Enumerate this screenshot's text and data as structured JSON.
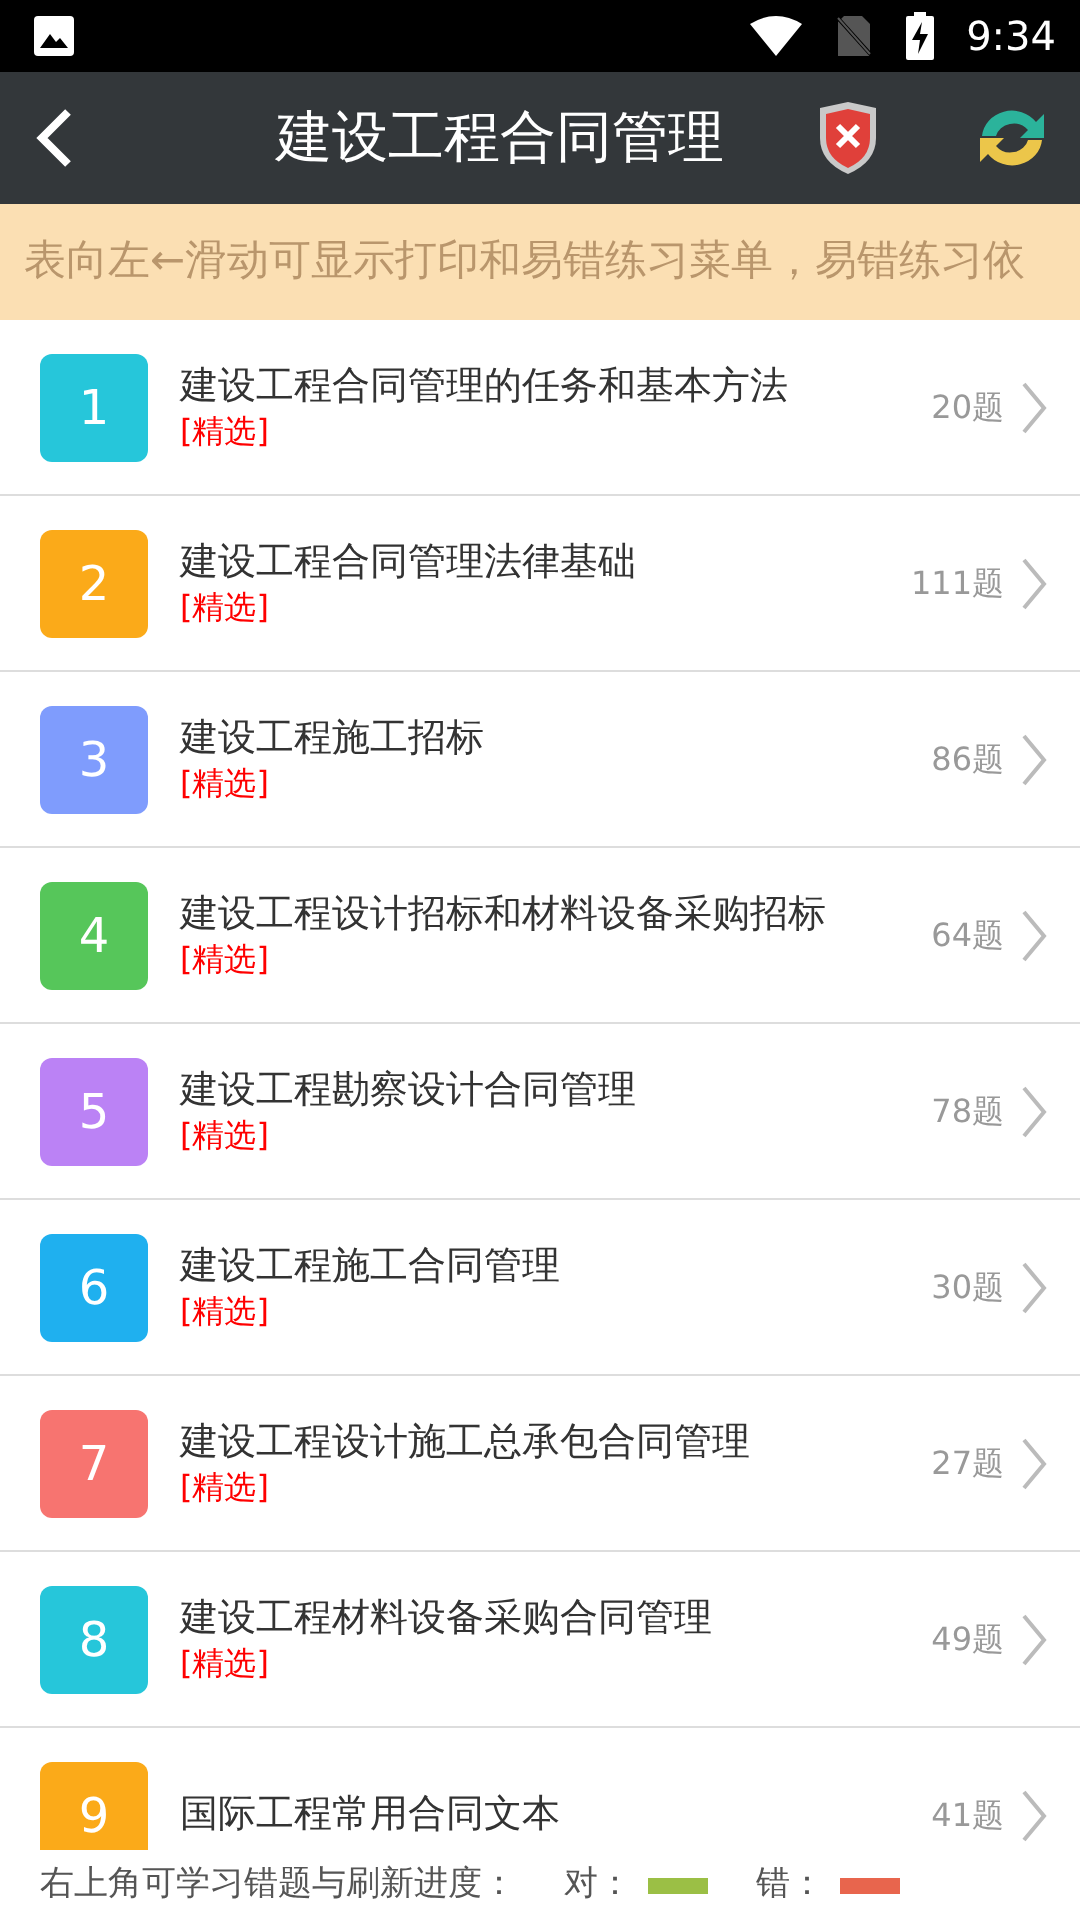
{
  "status_bar": {
    "time": "9:34"
  },
  "header": {
    "title": "建设工程合同管理"
  },
  "banner": {
    "text": "表向左←滑动可显示打印和易错练习菜单，易错练习依"
  },
  "chapters": [
    {
      "number": "1",
      "title": "建设工程合同管理的任务和基本方法",
      "tag": "[精选]",
      "count": "20题",
      "color": "#26c6da"
    },
    {
      "number": "2",
      "title": "建设工程合同管理法律基础",
      "tag": "[精选]",
      "count": "111题",
      "color": "#fbaa19"
    },
    {
      "number": "3",
      "title": "建设工程施工招标",
      "tag": "[精选]",
      "count": "86题",
      "color": "#7f9cfd"
    },
    {
      "number": "4",
      "title": "建设工程设计招标和材料设备采购招标",
      "tag": "[精选]",
      "count": "64题",
      "color": "#56c65a"
    },
    {
      "number": "5",
      "title": "建设工程勘察设计合同管理",
      "tag": "[精选]",
      "count": "78题",
      "color": "#bb82f5"
    },
    {
      "number": "6",
      "title": "建设工程施工合同管理",
      "tag": "[精选]",
      "count": "30题",
      "color": "#1fb0ef"
    },
    {
      "number": "7",
      "title": "建设工程设计施工总承包合同管理",
      "tag": "[精选]",
      "count": "27题",
      "color": "#f77470"
    },
    {
      "number": "8",
      "title": "建设工程材料设备采购合同管理",
      "tag": "[精选]",
      "count": "49题",
      "color": "#26c6da"
    },
    {
      "number": "9",
      "title": "国际工程常用合同文本",
      "count": "41题",
      "color": "#fbaa19"
    }
  ],
  "footer": {
    "hint": "右上角可学习错题与刷新进度：",
    "legend": [
      {
        "label": "对：",
        "color": "#9bbf45"
      },
      {
        "label": "错：",
        "color": "#e8654d"
      }
    ]
  }
}
